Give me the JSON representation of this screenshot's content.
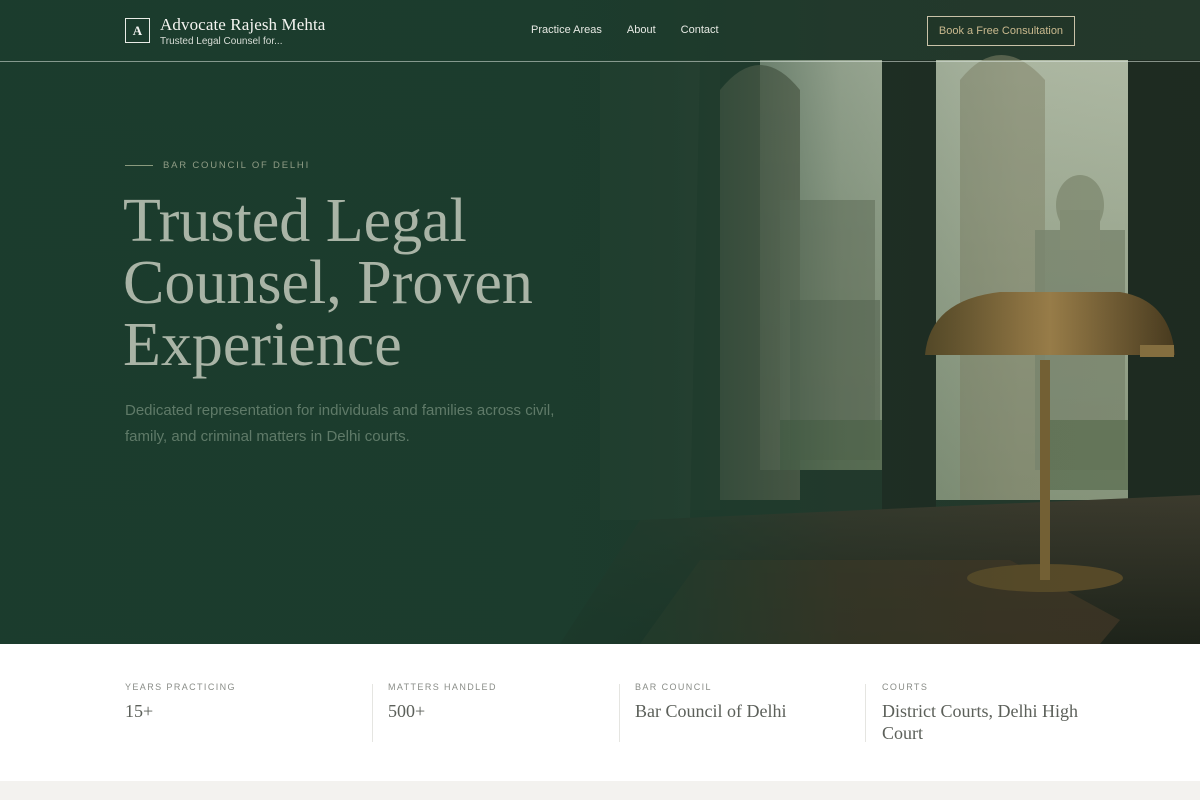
{
  "header": {
    "brand_mark": "A",
    "brand_name": "Advocate Rajesh Mehta",
    "brand_tagline": "Trusted Legal Counsel for...",
    "nav": [
      {
        "label": "Practice Areas"
      },
      {
        "label": "About"
      },
      {
        "label": "Contact"
      }
    ],
    "cta_label": "Book a Free Consultation"
  },
  "hero": {
    "eyebrow": "BAR COUNCIL OF DELHI",
    "title_lines": [
      "Trusted Legal",
      "Counsel, Proven",
      "Experience"
    ],
    "subtitle": "Dedicated representation for individuals and families across civil, family, and criminal matters in Delhi courts."
  },
  "stats": [
    {
      "label": "YEARS PRACTICING",
      "value": "15+"
    },
    {
      "label": "MATTERS HANDLED",
      "value": "500+"
    },
    {
      "label": "BAR COUNCIL",
      "value": "Bar Council of Delhi"
    },
    {
      "label": "COURTS",
      "value": "District Courts, Delhi High Court"
    }
  ],
  "colors": {
    "hero_green": "#1f3f30",
    "accent_gold": "#c9b98e",
    "title": "#a9b4a6"
  }
}
